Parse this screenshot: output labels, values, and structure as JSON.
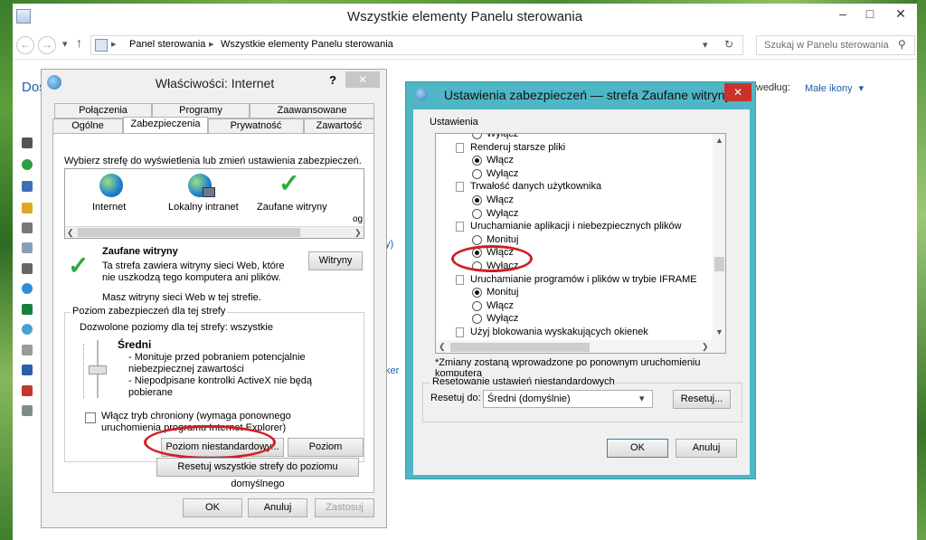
{
  "explorer": {
    "title": "Wszystkie elementy Panelu sterowania",
    "breadcrumb": [
      "Panel sterowania",
      "Wszystkie elementy Panelu sterowania"
    ],
    "search_placeholder": "Szukaj w Panelu sterowania",
    "view_label": "według:",
    "view_value": "Małe ikony",
    "partial_heading": "Dos",
    "partial_right_1": "y)",
    "partial_right_2": "ker"
  },
  "internet_properties": {
    "title": "Właściwości: Internet",
    "help": "?",
    "tabs_top": [
      "Połączenia",
      "Programy",
      "Zaawansowane"
    ],
    "tabs_bottom": [
      "Ogólne",
      "Zabezpieczenia",
      "Prywatność",
      "Zawartość"
    ],
    "zone_prompt": "Wybierz strefę do wyświetlenia lub zmień ustawienia zabezpieczeń.",
    "zones": [
      "Internet",
      "Lokalny intranet",
      "Zaufane witryny"
    ],
    "zone_partial": "og",
    "selected_zone": {
      "name": "Zaufane witryny",
      "desc": "Ta strefa zawiera witryny sieci Web, które nie uszkodzą tego komputera ani plików.",
      "sites_note": "Masz witryny sieci Web w tej strefie.",
      "sites_button": "Witryny"
    },
    "security_level": {
      "group_label": "Poziom zabezpieczeń dla tej strefy",
      "allowed": "Dozwolone poziomy dla tej strefy: wszystkie",
      "level": "Średni",
      "bullet1": "- Monituje przed pobraniem potencjalnie niebezpiecznej zawartości",
      "bullet2": "- Niepodpisane kontrolki ActiveX nie będą pobierane",
      "protected_mode": "Włącz tryb chroniony (wymaga ponownego uruchomienia programu Internet Explorer)",
      "protected_checked": false,
      "custom_button": "Poziom niestandardowy...",
      "default_button": "Poziom domyślny",
      "reset_all_button": "Resetuj wszystkie strefy do poziomu domyślnego"
    },
    "ok": "OK",
    "cancel": "Anuluj",
    "apply": "Zastosuj"
  },
  "security_settings": {
    "title": "Ustawienia zabezpieczeń — strefa Zaufane witryny",
    "settings_label": "Ustawienia",
    "items": [
      {
        "type": "radio",
        "label": "Wyłącz",
        "checked": false
      },
      {
        "type": "header",
        "label": "Renderuj starsze pliki"
      },
      {
        "type": "radio",
        "label": "Włącz",
        "checked": true
      },
      {
        "type": "radio",
        "label": "Wyłącz",
        "checked": false
      },
      {
        "type": "header",
        "label": "Trwałość danych użytkownika"
      },
      {
        "type": "radio",
        "label": "Włącz",
        "checked": true
      },
      {
        "type": "radio",
        "label": "Wyłącz",
        "checked": false
      },
      {
        "type": "header",
        "label": "Uruchamianie aplikacji i niebezpiecznych plików"
      },
      {
        "type": "radio",
        "label": "Monituj",
        "checked": false
      },
      {
        "type": "radio",
        "label": "Włącz",
        "checked": true
      },
      {
        "type": "radio",
        "label": "Wyłącz",
        "checked": false
      },
      {
        "type": "header",
        "label": "Uruchamianie programów i plików w trybie IFRAME"
      },
      {
        "type": "radio",
        "label": "Monituj",
        "checked": true
      },
      {
        "type": "radio",
        "label": "Włącz",
        "checked": false
      },
      {
        "type": "radio",
        "label": "Wyłącz",
        "checked": false
      },
      {
        "type": "header",
        "label": "Użyj blokowania wyskakujących okienek"
      }
    ],
    "restart_note": "*Zmiany zostaną wprowadzone po ponownym uruchomieniu komputera",
    "reset_group": "Resetowanie ustawień niestandardowych",
    "reset_to_label": "Resetuj do:",
    "reset_to_value": "Średni (domyślnie)",
    "reset_button": "Resetuj...",
    "ok": "OK",
    "cancel": "Anuluj"
  },
  "colors": {
    "accent_teal": "#4fb6c6",
    "highlight_red": "#d01f26",
    "dialog_bg": "#f0f0f0",
    "link_blue": "#1e5fa8"
  }
}
